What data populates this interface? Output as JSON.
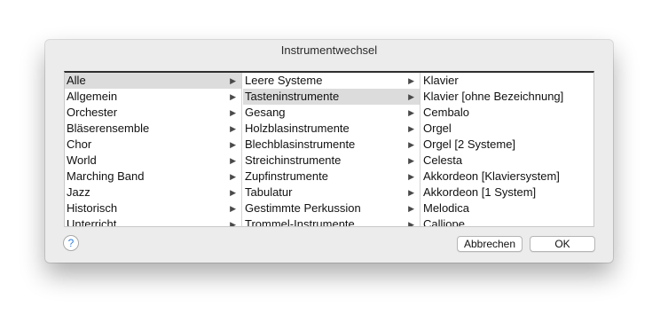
{
  "dialog": {
    "title": "Instrumentwechsel",
    "help_label": "?",
    "cancel_label": "Abbrechen",
    "ok_label": "OK"
  },
  "columns": {
    "categories": {
      "selected": "Alle",
      "items": [
        "Alle",
        "Allgemein",
        "Orchester",
        "Bläserensemble",
        "Chor",
        "World",
        "Marching Band",
        "Jazz",
        "Historisch",
        "Unterricht"
      ]
    },
    "families": {
      "selected": "Tasteninstrumente",
      "items": [
        "Leere Systeme",
        "Tasteninstrumente",
        "Gesang",
        "Holzblasinstrumente",
        "Blechblasinstrumente",
        "Streichinstrumente",
        "Zupfinstrumente",
        "Tabulatur",
        "Gestimmte Perkussion",
        "Trommel-Instrumente"
      ]
    },
    "instruments": {
      "items": [
        "Klavier",
        "Klavier [ohne Bezeichnung]",
        "Cembalo",
        "Orgel",
        "Orgel [2 Systeme]",
        "Celesta",
        "Akkordeon [Klaviersystem]",
        "Akkordeon [1 System]",
        "Melodica",
        "Calliope"
      ]
    }
  },
  "icons": {
    "expand_arrow": "triangle-right-icon",
    "help": "help-icon"
  }
}
